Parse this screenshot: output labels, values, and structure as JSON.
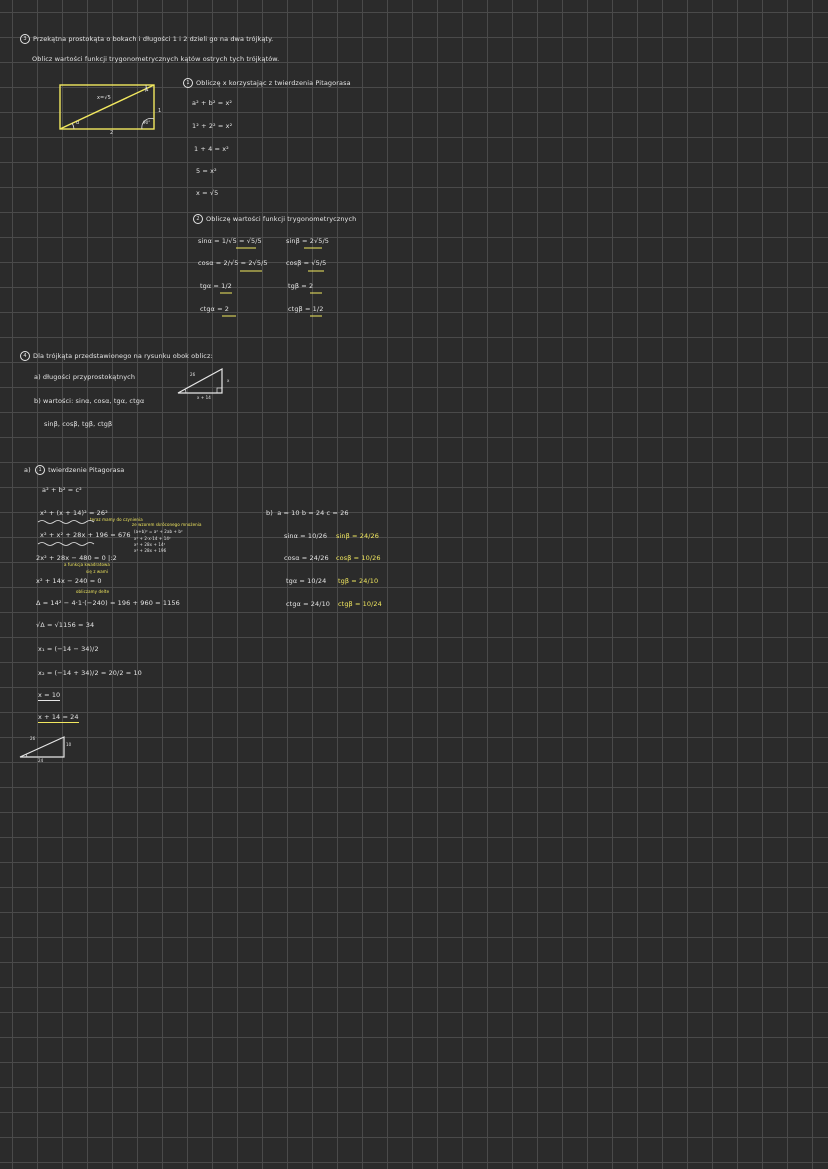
{
  "task3": {
    "number": "3",
    "statement": "Przekątna prostokąta o bokach i długości 1 i 2 dzieli go na dwa trójkąty.",
    "instruction": "Oblicz wartości funkcji trygonometrycznych kątów ostrych tych trójkątów.",
    "figure": {
      "hyp": "x=√5",
      "side_right": "1",
      "side_bottom": "2",
      "angle_a": "α",
      "angle_b": "β",
      "right": "90°"
    },
    "step1": {
      "number": "1",
      "title": "Obliczę x korzystając z twierdzenia Pitagorasa",
      "lines": [
        "a² + b² = x²",
        "1² + 2² = x²",
        "1 + 4 = x²",
        "5 = x²",
        "x = √5"
      ]
    },
    "step2": {
      "number": "2",
      "title": "Obliczę wartości funkcji trygonometrycznych",
      "left": [
        "sinα = 1/√5 = √5/5",
        "cosα = 2/√5 = 2√5/5",
        "tgα = 1/2",
        "ctgα = 2"
      ],
      "right": [
        "sinβ = 2√5/5",
        "cosβ = √5/5",
        "tgβ = 2",
        "ctgβ = 1/2"
      ]
    }
  },
  "task4": {
    "number": "4",
    "statement": "Dla trójkąta przedstawionego na rysunku obok oblicz:",
    "items": [
      "a) długości przyprostokątnych",
      "b) wartości: sinα, cosα, tgα, ctgα",
      "sinβ, cosβ, tgβ, ctgβ"
    ],
    "figure": {
      "hyp": "26",
      "leg_right": "x",
      "leg_bottom": "x + 14"
    },
    "part_a": {
      "label": "a)",
      "step_number": "1",
      "title": "twierdzenie Pitagorasa",
      "lines": [
        "a² + b² = c²",
        "x² + (x + 14)² = 26²",
        "x² + x² + 28x + 196 = 676",
        "2x² + 28x − 480 = 0  |:2",
        "x² + 14x − 240 = 0",
        "Δ = 14² − 4·1·(−240) = 196 + 960 = 1156",
        "√Δ = √1156 = 34",
        "x₁ = (−14 − 34)/2",
        "x₂ = (−14 + 34)/2 = 20/2 = 10",
        "x = 10",
        "x + 14 = 24"
      ],
      "notes": {
        "n1": "teraz mamy do czynienia",
        "n2": "ze wzorem skróconego mnożenia",
        "n3": "(a+b)² = a² + 2ab + b²",
        "n4": "x² + 2·x·14 + 14²",
        "n5": "x² + 28x + 14²",
        "n6": "x² + 28x + 196",
        "n7": "a  funkcja kwadratowa",
        "n8": "się z wami",
        "n9": "obliczamy delte"
      },
      "figure": {
        "hyp": "26",
        "leg": "10",
        "base": "24"
      }
    },
    "part_b": {
      "label": "b)",
      "given": "a = 10   b = 24   c = 26",
      "left": [
        "sinα = 10/26",
        "cosα = 24/26",
        "tgα = 10/24",
        "ctgα = 24/10"
      ],
      "right": [
        "sinβ = 24/26",
        "cosβ = 10/26",
        "tgβ = 24/10",
        "ctgβ = 10/24"
      ]
    }
  }
}
